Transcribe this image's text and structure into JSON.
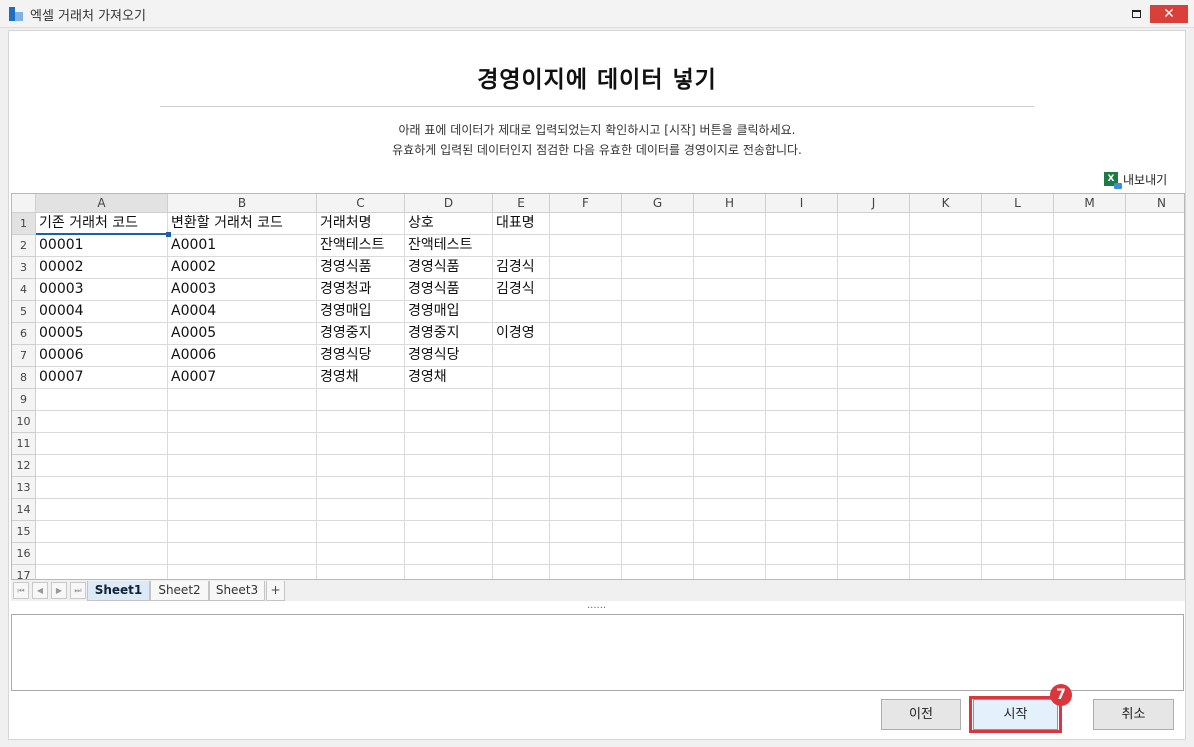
{
  "window": {
    "title": "엑셀 거래처 가져오기",
    "maximize_icon": "maximize-icon",
    "close_icon": "close-icon",
    "close_glyph": "✕"
  },
  "header": {
    "title": "경영이지에 데이터 넣기",
    "desc_line1": "아래 표에 데이터가 제대로 입력되었는지 확인하시고 [시작] 버튼을 클릭하세요.",
    "desc_line2": "유효하게 입력된 데이터인지 점검한 다음 유효한 데이터를 경영이지로 전송합니다."
  },
  "toolbar": {
    "export_label": "내보내기",
    "export_icon": "excel-export-icon",
    "export_icon_glyph": "X"
  },
  "sheet": {
    "columns": [
      "A",
      "B",
      "C",
      "D",
      "E",
      "F",
      "G",
      "H",
      "I",
      "J",
      "K",
      "L",
      "M",
      "N"
    ],
    "row_numbers": [
      "1",
      "2",
      "3",
      "4",
      "5",
      "6",
      "7",
      "8",
      "9",
      "10",
      "11",
      "12",
      "13",
      "14",
      "15",
      "16",
      "17"
    ],
    "active_cell": "A1",
    "rows": [
      [
        "기존 거래처 코드",
        "변환할 거래처 코드",
        "거래처명",
        "상호",
        "대표명"
      ],
      [
        "00001",
        "A0001",
        "잔액테스트",
        "잔액테스트",
        ""
      ],
      [
        "00002",
        "A0002",
        "경영식품",
        "경영식품",
        "김경식"
      ],
      [
        "00003",
        "A0003",
        "경영청과",
        "경영식품",
        "김경식"
      ],
      [
        "00004",
        "A0004",
        "경영매입",
        "경영매입",
        ""
      ],
      [
        "00005",
        "A0005",
        "경영중지",
        "경영중지",
        "이경영"
      ],
      [
        "00006",
        "A0006",
        "경영식당",
        "경영식당",
        ""
      ],
      [
        "00007",
        "A0007",
        "경영채",
        "경영채",
        ""
      ]
    ]
  },
  "sheet_tabs": {
    "nav": [
      "⏮",
      "◀",
      "▶",
      "⏭"
    ],
    "tabs": [
      "Sheet1",
      "Sheet2",
      "Sheet3"
    ],
    "active": "Sheet1",
    "add_glyph": "+"
  },
  "splitter_glyph": "......",
  "buttons": {
    "prev_label": "이전",
    "start_label": "시작",
    "cancel_label": "취소"
  },
  "annotation": {
    "step_number": "7"
  }
}
